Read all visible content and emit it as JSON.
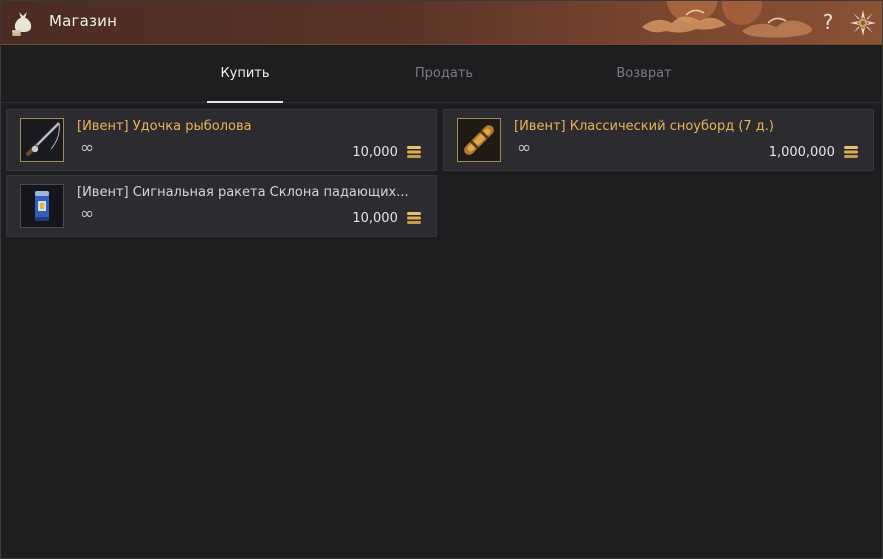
{
  "window": {
    "title": "Магазин",
    "help_glyph": "?",
    "icons": {
      "title": "money-bag-icon",
      "help": "question-icon",
      "emblem": "sun-emblem-icon"
    }
  },
  "tabs": [
    {
      "label": "Купить",
      "active": true
    },
    {
      "label": "Продать",
      "active": false
    },
    {
      "label": "Возврат",
      "active": false
    }
  ],
  "items": [
    {
      "name": "[Ивент] Удочка рыболова",
      "stock": "∞",
      "price": "10,000",
      "name_color": "#e8b25a",
      "icon": "fishing-rod-icon"
    },
    {
      "name": "[Ивент] Классический сноуборд (7 д.)",
      "stock": "∞",
      "price": "1,000,000",
      "name_color": "#e8b25a",
      "icon": "snowboard-icon"
    },
    {
      "name": "[Ивент] Сигнальная ракета Склона падающих...",
      "stock": "∞",
      "price": "10,000",
      "name_color": "#d6d6d6",
      "icon": "signal-flare-icon"
    }
  ],
  "currency_icon": "silver-coin-stack-icon",
  "colors": {
    "accent": "#e8b25a",
    "background": "#1e1e20",
    "item_bg": "#2c2c30",
    "title_bar": "#5a3327"
  }
}
